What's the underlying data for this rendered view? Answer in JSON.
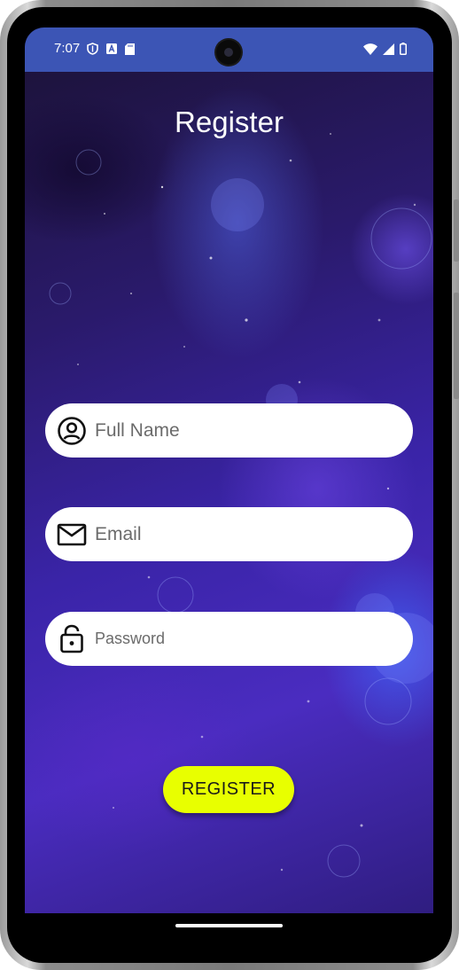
{
  "status_bar": {
    "time": "7:07",
    "left_icons": [
      "shield-icon",
      "a-badge-icon",
      "sd-card-icon"
    ],
    "right_icons": [
      "wifi-icon",
      "signal-icon",
      "battery-icon"
    ],
    "background": "#3c55b5"
  },
  "page": {
    "title": "Register"
  },
  "form": {
    "full_name": {
      "placeholder": "Full Name",
      "icon": "account-circle-icon"
    },
    "email": {
      "placeholder": "Email",
      "icon": "mail-icon"
    },
    "password": {
      "placeholder": "Password",
      "icon": "lock-open-icon"
    }
  },
  "actions": {
    "register_label": "REGISTER",
    "button_color": "#e8ff00"
  }
}
